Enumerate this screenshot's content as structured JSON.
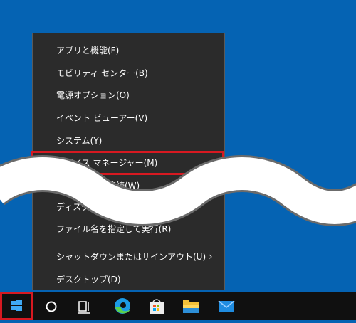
{
  "menu": {
    "items": [
      {
        "label": "アプリと機能(F)"
      },
      {
        "label": "モビリティ センター(B)"
      },
      {
        "label": "電源オプション(O)"
      },
      {
        "label": "イベント ビューアー(V)"
      },
      {
        "label": "システム(Y)"
      },
      {
        "label": "デバイス マネージャー(M)",
        "highlighted": true
      },
      {
        "label": "ネットワーク接続(W)"
      },
      {
        "label": "ディスクの管理(K)"
      },
      {
        "label": "ファイル名を指定して実行(R)"
      },
      {
        "label": "シャットダウンまたはサインアウト(U)",
        "has_submenu": true
      },
      {
        "label": "デスクトップ(D)"
      }
    ],
    "submenu_arrow": "›"
  },
  "taskbar": {
    "icons": [
      "start-icon",
      "cortana-icon",
      "task-view-icon",
      "edge-icon",
      "store-icon",
      "file-explorer-icon",
      "mail-icon"
    ]
  },
  "colors": {
    "desktop": "#0563b3",
    "menu_bg": "#2b2b2b",
    "highlight_border": "#d71921",
    "taskbar": "#101010"
  }
}
